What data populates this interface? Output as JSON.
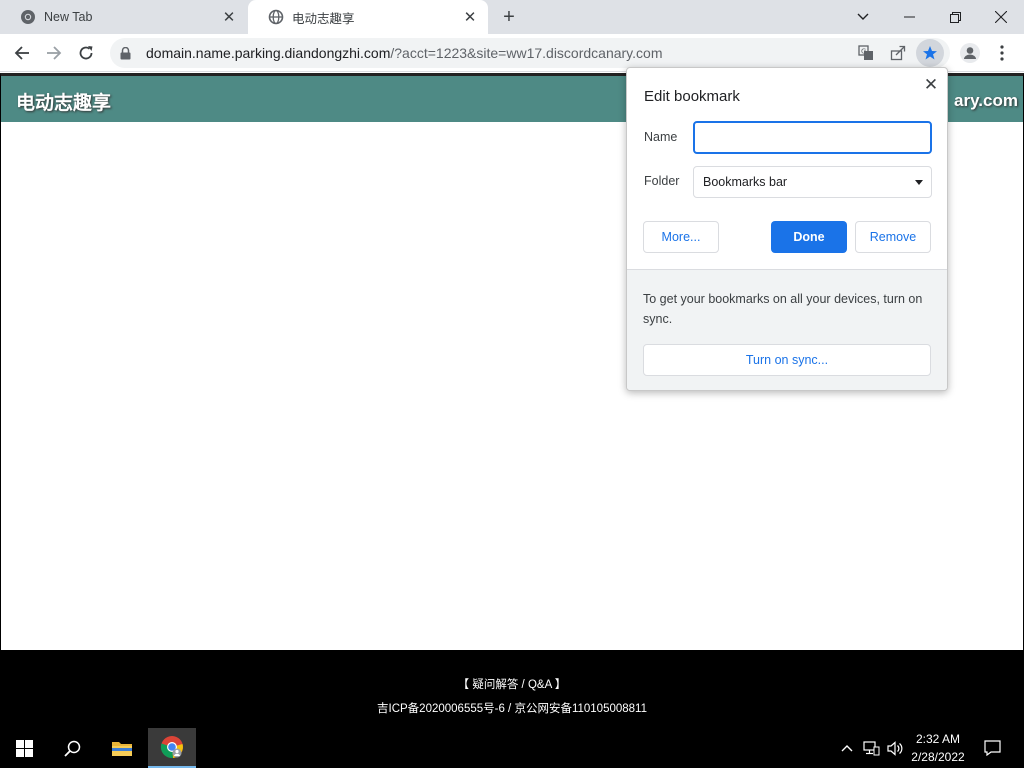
{
  "browser": {
    "tabs": [
      {
        "title": "New Tab",
        "favicon": "chrome-icon",
        "active": false
      },
      {
        "title": "电动志趣享",
        "favicon": "globe-icon",
        "active": true
      }
    ],
    "omnibox": {
      "url_host": "domain.name.parking.diandongzhi.com",
      "url_rest": "/?acct=1223&site=ww17.discordcanary.com"
    }
  },
  "site": {
    "title": "电动志趣享",
    "domain_partial": "ary.com",
    "footer_faq": "【 疑问解答 / Q&A 】",
    "footer_icp": "吉ICP备2020006555号-6 / 京公网安备110105008811",
    "header_color": "#4e8a85"
  },
  "bookmark_popup": {
    "title": "Edit bookmark",
    "name_label": "Name",
    "name_value": "",
    "folder_label": "Folder",
    "folder_value": "Bookmarks bar",
    "more_button": "More...",
    "done_button": "Done",
    "remove_button": "Remove",
    "sync_text": "To get your bookmarks on all your devices, turn on sync.",
    "sync_button": "Turn on sync...",
    "accent_color": "#1a73e8"
  },
  "taskbar": {
    "time": "2:32 AM",
    "date": "2/28/2022"
  }
}
